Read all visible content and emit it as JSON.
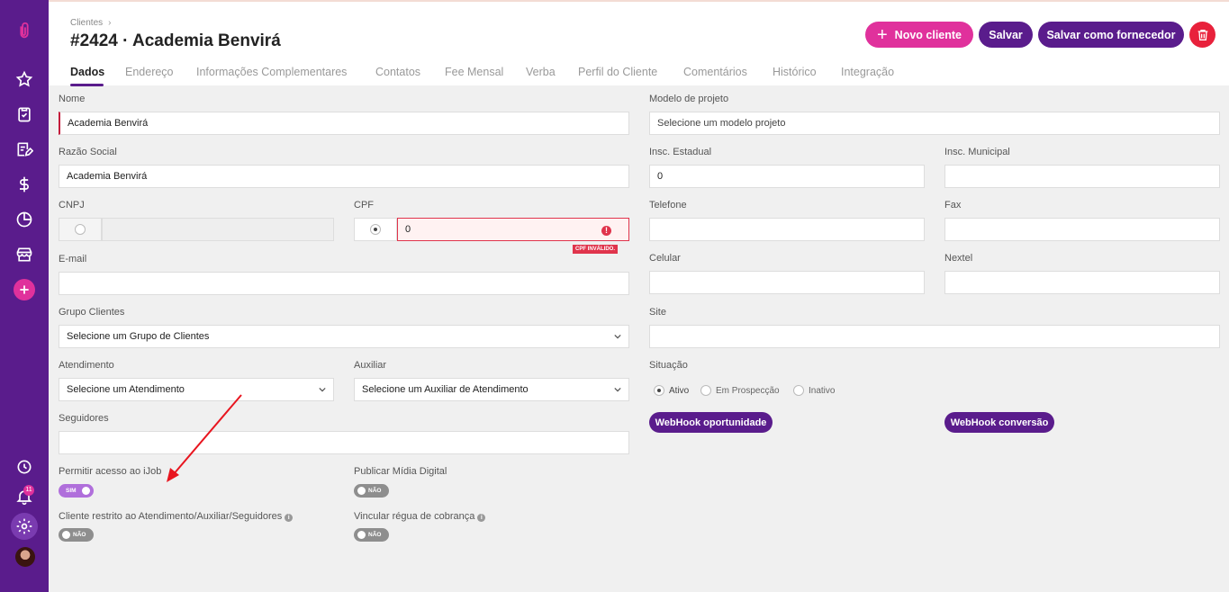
{
  "app": {
    "breadcrumb": "Clientes",
    "title": "#2424 · Academia Benvirá"
  },
  "actions": {
    "new_client": "Novo cliente",
    "save": "Salvar",
    "save_supplier": "Salvar como fornecedor"
  },
  "sidebar": {
    "notification_count": "11",
    "icons": [
      "paperclip-logo-icon",
      "star-icon",
      "clipboard-check-icon",
      "edit-note-icon",
      "dollar-icon",
      "pie-chart-icon",
      "store-icon",
      "plus-icon",
      "clock-icon",
      "bell-icon",
      "gear-icon",
      "avatar"
    ]
  },
  "tabs": [
    "Dados",
    "Endereço",
    "Informações Complementares",
    "Contatos",
    "Fee Mensal",
    "Verba",
    "Perfil do Cliente",
    "Comentários",
    "Histórico",
    "Integração"
  ],
  "form": {
    "nome": {
      "label": "Nome",
      "value": "Academia Benvirá"
    },
    "modelo_projeto": {
      "label": "Modelo de projeto",
      "value": "Selecione um modelo projeto"
    },
    "razao_social": {
      "label": "Razão Social",
      "value": "Academia Benvirá"
    },
    "insc_estadual": {
      "label": "Insc. Estadual",
      "value": "0"
    },
    "insc_municipal": {
      "label": "Insc. Municipal",
      "value": ""
    },
    "cnpj": {
      "label": "CNPJ",
      "value": ""
    },
    "cpf": {
      "label": "CPF",
      "value": "0",
      "error": "CPF INVÁLIDO."
    },
    "telefone": {
      "label": "Telefone",
      "value": ""
    },
    "fax": {
      "label": "Fax",
      "value": ""
    },
    "email": {
      "label": "E-mail",
      "value": ""
    },
    "celular": {
      "label": "Celular",
      "value": ""
    },
    "nextel": {
      "label": "Nextel",
      "value": ""
    },
    "grupo_clientes": {
      "label": "Grupo Clientes",
      "value": "Selecione um Grupo de Clientes"
    },
    "site": {
      "label": "Site",
      "value": ""
    },
    "atendimento": {
      "label": "Atendimento",
      "value": "Selecione um Atendimento"
    },
    "auxiliar": {
      "label": "Auxiliar",
      "value": "Selecione um Auxiliar de Atendimento"
    },
    "situacao": {
      "label": "Situação",
      "options": [
        "Ativo",
        "Em Prospecção",
        "Inativo"
      ],
      "selected": "Ativo"
    },
    "seguidores": {
      "label": "Seguidores",
      "value": ""
    },
    "permitir_ijob": {
      "label": "Permitir acesso ao iJob",
      "state": "SIM"
    },
    "publicar_midia": {
      "label": "Publicar Mídia Digital",
      "state": "NÃO"
    },
    "cliente_restrito": {
      "label": "Cliente restrito ao Atendimento/Auxiliar/Seguidores",
      "state": "NÃO"
    },
    "vincular_regua": {
      "label": "Vincular régua de cobrança",
      "state": "NÃO"
    }
  },
  "webhooks": {
    "oportunidade": "WebHook oportunidade",
    "conversao": "WebHook conversão"
  },
  "colors": {
    "sidebar": "#5a1c8c",
    "accent_pink": "#e0319c",
    "primary_purple": "#5a1c8c",
    "danger_red": "#e8213b",
    "annotation_arrow": "#e8151f"
  }
}
